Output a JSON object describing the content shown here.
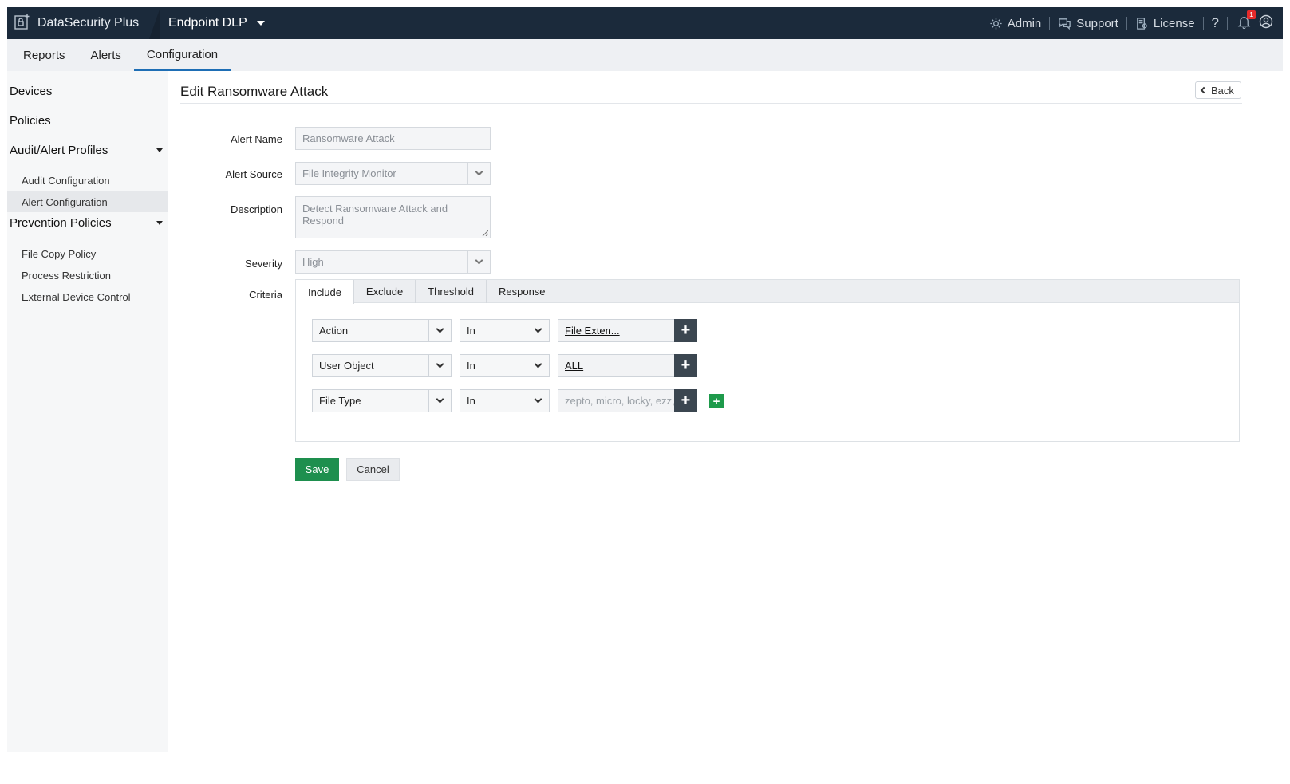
{
  "app": {
    "brand": "DataSecurity Plus",
    "product": "Endpoint DLP"
  },
  "top_links": {
    "admin": "Admin",
    "support": "Support",
    "license": "License",
    "help": "?",
    "notification_count": "1"
  },
  "main_tabs": [
    {
      "label": "Reports"
    },
    {
      "label": "Alerts"
    },
    {
      "label": "Configuration",
      "active": true
    }
  ],
  "sidebar": {
    "devices": "Devices",
    "policies": "Policies",
    "audit_alert_profiles": "Audit/Alert Profiles",
    "audit_configuration": "Audit Configuration",
    "alert_configuration": "Alert Configuration",
    "prevention_policies": "Prevention Policies",
    "file_copy_policy": "File Copy Policy",
    "process_restriction": "Process Restriction",
    "external_device_control": "External Device Control"
  },
  "page": {
    "title": "Edit Ransomware Attack",
    "back": "Back"
  },
  "form": {
    "alert_name_label": "Alert Name",
    "alert_name_value": "Ransomware Attack",
    "alert_source_label": "Alert Source",
    "alert_source_value": "File Integrity Monitor",
    "description_label": "Description",
    "description_value": "Detect Ransomware Attack and Respond",
    "severity_label": "Severity",
    "severity_value": "High",
    "criteria_label": "Criteria"
  },
  "criteria_tabs": [
    {
      "label": "Include",
      "active": true
    },
    {
      "label": "Exclude"
    },
    {
      "label": "Threshold"
    },
    {
      "label": "Response"
    }
  ],
  "criteria_rows": [
    {
      "field": "Action",
      "operator": "In",
      "value": "File Exten..."
    },
    {
      "field": "User Object",
      "operator": "In",
      "value": "ALL"
    },
    {
      "field": "File Type",
      "operator": "In",
      "value": "zepto, micro, locky, ezz, exx, xyz, aaa, abc, ccc, vvv, xxx, ttt, micro, encrypted, locked, crypto"
    }
  ],
  "actions": {
    "save": "Save",
    "cancel": "Cancel"
  },
  "colors": {
    "topbar": "#1b2a3b",
    "accent": "#1e6eb5",
    "save": "#1e8f4e",
    "add_row": "#1e9a4b",
    "plus": "#3b4650"
  }
}
